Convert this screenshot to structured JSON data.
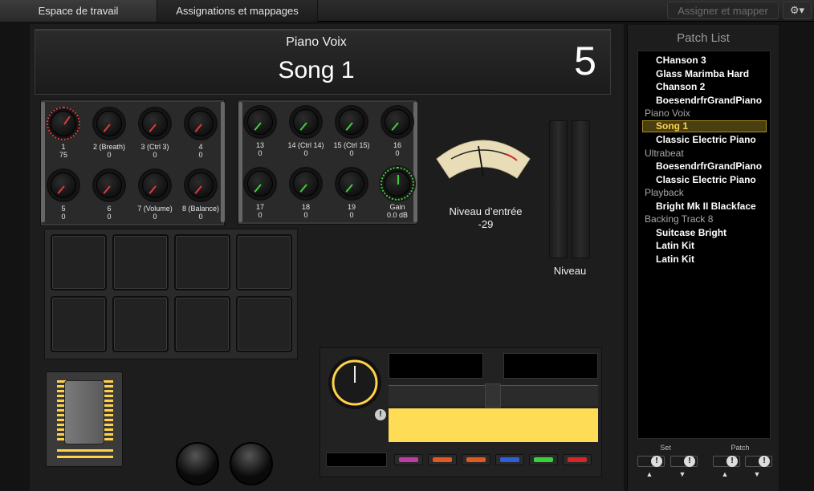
{
  "tabs": [
    {
      "label": "Espace de travail"
    },
    {
      "label": "Assignations et mappages"
    }
  ],
  "toolbar": {
    "assign_label": "Assigner et mapper",
    "gear": "⚙︎▾"
  },
  "header": {
    "set_name": "Piano Voix",
    "song_name": "Song 1",
    "song_number": "5"
  },
  "knobs_left": [
    {
      "label": "1",
      "value": "75"
    },
    {
      "label": "2 (Breath)",
      "value": "0"
    },
    {
      "label": "3 (Ctrl 3)",
      "value": "0"
    },
    {
      "label": "4",
      "value": "0"
    },
    {
      "label": "5",
      "value": "0"
    },
    {
      "label": "6",
      "value": "0"
    },
    {
      "label": "7 (Volume)",
      "value": "0"
    },
    {
      "label": "8 (Balance)",
      "value": "0"
    }
  ],
  "knobs_right": [
    {
      "label": "13",
      "value": "0"
    },
    {
      "label": "14 (Ctrl 14)",
      "value": "0"
    },
    {
      "label": "15 (Ctrl 15)",
      "value": "0"
    },
    {
      "label": "16",
      "value": "0"
    },
    {
      "label": "17",
      "value": "0"
    },
    {
      "label": "18",
      "value": "0"
    },
    {
      "label": "19",
      "value": "0"
    },
    {
      "label": "Gain",
      "value": "0.0 dB"
    }
  ],
  "vu": {
    "label": "Niveau d’entrée",
    "value": "-29"
  },
  "level_label": "Niveau",
  "patch_list": {
    "title": "Patch List",
    "items": [
      {
        "text": "CHanson 3",
        "kind": "song"
      },
      {
        "text": "Glass Marimba Hard",
        "kind": "song"
      },
      {
        "text": "Chanson 2",
        "kind": "song"
      },
      {
        "text": "BoesendrfrGrandPiano",
        "kind": "song"
      },
      {
        "text": "Piano Voix",
        "kind": "set"
      },
      {
        "text": "Song 1",
        "kind": "song",
        "selected": true
      },
      {
        "text": "Classic Electric Piano",
        "kind": "song"
      },
      {
        "text": "Ultrabeat",
        "kind": "set"
      },
      {
        "text": "BoesendrfrGrandPiano",
        "kind": "song"
      },
      {
        "text": "Classic Electric Piano",
        "kind": "song"
      },
      {
        "text": "Playback",
        "kind": "set"
      },
      {
        "text": "Bright Mk II Blackface",
        "kind": "song"
      },
      {
        "text": "Backing Track 8",
        "kind": "set"
      },
      {
        "text": "Suitcase Bright",
        "kind": "song"
      },
      {
        "text": "Latin Kit",
        "kind": "song"
      },
      {
        "text": "Latin Kit",
        "kind": "song"
      }
    ],
    "nav_set_label": "Set",
    "nav_patch_label": "Patch",
    "bang": "!",
    "up": "▲",
    "down": "▼"
  },
  "colors": {
    "accent": "#ffd24a",
    "selection_bg": "#4a3f10",
    "knob_red": "#e03a3a",
    "knob_green": "#3ad13a"
  },
  "transport_switch_colors": [
    "#c13aa8",
    "#e0591f",
    "#e0591f",
    "#2f5fd8",
    "#3ad13a",
    "#d6262a"
  ]
}
